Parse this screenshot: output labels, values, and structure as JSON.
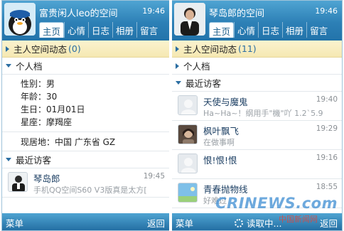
{
  "left": {
    "header": {
      "title": "富贵闲人leo的空间",
      "time": "19:46"
    },
    "tabs": [
      "主页",
      "心情",
      "日志",
      "相册",
      "留言"
    ],
    "feed": {
      "label": "主人空间动态",
      "count": "(0)"
    },
    "profile": {
      "label": "个人档",
      "lines": [
        "性别：男",
        "年龄：30",
        "生日：01月01日",
        "星座：摩羯座"
      ],
      "location": "现居地：中国 广东省 GZ"
    },
    "visitors": {
      "label": "最近访客",
      "items": [
        {
          "name": "琴岛郎",
          "time": "19:45",
          "message": "手机QQ空间S60 V3版真是太方["
        }
      ]
    },
    "softkeys": {
      "left": "菜单",
      "right": "返回"
    }
  },
  "right": {
    "header": {
      "title": "琴岛郎的空间",
      "time": "19:46"
    },
    "tabs": [
      "主页",
      "心情",
      "日志",
      "相册",
      "留言"
    ],
    "feed": {
      "label": "主人空间动态",
      "count": "(11)"
    },
    "profile": {
      "label": "个人档"
    },
    "visitors": {
      "label": "最近访客",
      "items": [
        {
          "name": "天使与魔鬼",
          "time": "19:40",
          "message": "Ha~Ha~！纲用手\"機\"吖 1.2`5.9"
        },
        {
          "name": "枫叶飘飞",
          "time": "19:29",
          "message": "在做事啊"
        },
        {
          "name": "恨!恨!恨",
          "time": "19:16",
          "message": ""
        },
        {
          "name": "青春抛物线",
          "time": "18:55",
          "message": "好难过"
        }
      ]
    },
    "softkeys": {
      "left": "菜单",
      "center": "读取中...",
      "right": "返回"
    }
  },
  "watermark": {
    "text": "CRINEWS.com",
    "subtext": "中国新闻网"
  },
  "colors": {
    "header": "#2d80b6",
    "highlight_row": "#f5e8b2",
    "accent": "#2b6ea2"
  }
}
